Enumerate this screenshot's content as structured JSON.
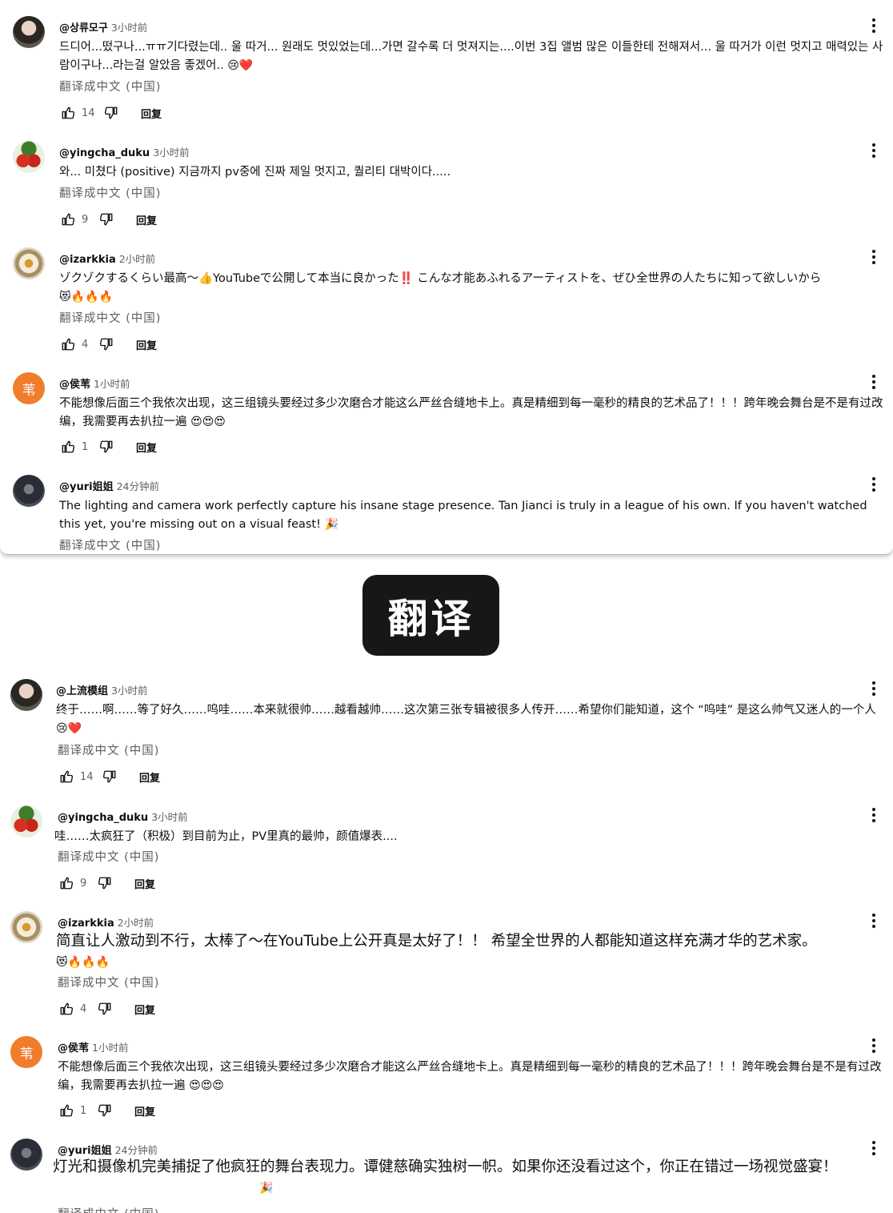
{
  "translate_label": "翻译成中文 (中国)",
  "reply_label": "回复",
  "banner_text": "翻译",
  "top_comments": [
    {
      "author": "@상류모구",
      "time": "3小时前",
      "avatar": "portrait",
      "avatar_letter": "",
      "likes": "14",
      "text": "드디어...떴구나...ㅠㅠ기다렸는데.. 울 따거... 원래도 멋있었는데...가면 갈수록 더 멋져지는....이번 3집 앨범 많은 이들한테 전해져서... 울 따거가 이런 멋지고 매력있는 사람이구나...라는걸 알았음 좋겠어..",
      "emoji": "😢❤️"
    },
    {
      "author": "@yingcha_duku",
      "time": "3小时前",
      "avatar": "cherry",
      "avatar_letter": "",
      "likes": "9",
      "text": "와... 미쳤다 (positive) 지금까지 pv중에 진짜 제일 멋지고, 퀄리티 대박이다.....",
      "emoji": ""
    },
    {
      "author": "@izarkkia",
      "time": "2小时前",
      "avatar": "flower",
      "avatar_letter": "",
      "likes": "4",
      "text": "ゾクゾクするくらい最高～👍YouTubeで公開して本当に良かった‼️ こんな才能あふれるアーティストを、ぜひ全世界の人たちに知って欲しいから",
      "emoji": "😻🔥🔥🔥"
    },
    {
      "author": "@侯苇",
      "time": "1小时前",
      "avatar": "letter",
      "avatar_letter": "苇",
      "likes": "1",
      "text": "不能想像后面三个我依次出现，这三组镜头要经过多少次磨合才能这么严丝合缝地卡上。真是精细到每一毫秒的精良的艺术品了！！！跨年晚会舞台是不是有过改编，我需要再去扒拉一遍",
      "emoji": "😍😍😍"
    },
    {
      "author": "@yuri姐姐",
      "time": "24分钟前",
      "avatar": "dark",
      "avatar_letter": "",
      "likes": "",
      "text": "The lighting and camera work perfectly capture his insane stage presence. Tan Jianci is truly in a league of his own. If you haven't watched this yet, you're missing out on a visual feast!",
      "emoji": "🎉"
    }
  ],
  "bottom_comments": [
    {
      "author": "@上流模组",
      "time": "3小时前",
      "avatar": "portrait",
      "avatar_letter": "",
      "likes": "14",
      "text": "终于……啊……等了好久……呜哇……本来就很帅……越看越帅……这次第三张专辑被很多人传开……希望你们能知道，这个 “呜哇” 是这么帅气又迷人的一个人",
      "emoji": "😢❤️"
    },
    {
      "author": "@yingcha_duku",
      "time": "3小时前",
      "avatar": "cherry",
      "avatar_letter": "",
      "likes": "9",
      "text": "哇……太疯狂了（积极）到目前为止，PV里真的最帅，颜值爆表....",
      "emoji": ""
    },
    {
      "author": "@izarkkia",
      "time": "2小时前",
      "avatar": "flower",
      "avatar_letter": "",
      "likes": "4",
      "text": "简直让人激动到不行，太棒了～在YouTube上公开真是太好了！！ 希望全世界的人都能知道这样充满才华的艺术家。",
      "emoji": "😻🔥🔥🔥"
    },
    {
      "author": "@侯苇",
      "time": "1小时前",
      "avatar": "letter",
      "avatar_letter": "苇",
      "likes": "1",
      "text": "不能想像后面三个我依次出现，这三组镜头要经过多少次磨合才能这么严丝合缝地卡上。真是精细到每一毫秒的精良的艺术品了！！！跨年晚会舞台是不是有过改编，我需要再去扒拉一遍",
      "emoji": "😍😍😍"
    },
    {
      "author": "@yuri姐姐",
      "time": "24分钟前",
      "avatar": "dark",
      "avatar_letter": "",
      "likes": "",
      "text": "灯光和摄像机完美捕捉了他疯狂的舞台表现力。谭健慈确实独树一帜。如果你还没看过这个，你正在错过一场视觉盛宴！",
      "emoji": "🎉"
    }
  ]
}
